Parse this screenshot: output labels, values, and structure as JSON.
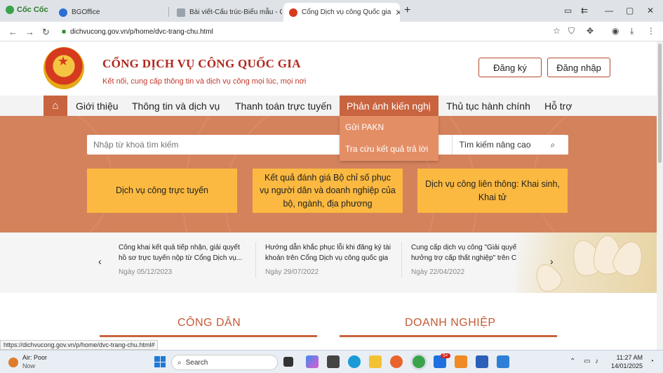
{
  "browser": {
    "brand": "Cốc Cốc",
    "tabs": [
      {
        "label": "BGOffice"
      },
      {
        "label": "Bài viết-Cấu trúc-Biểu mẫu - Cổng"
      },
      {
        "label": "Cổng Dịch vụ công Quốc gia"
      }
    ],
    "new_tab": "+",
    "url": "dichvucong.gov.vn/p/home/dvc-trang-chu.html",
    "status_url": "https://dichvucong.gov.vn/p/home/dvc-trang-chu.html#"
  },
  "site": {
    "title": "CỔNG DỊCH VỤ CÔNG QUỐC GIA",
    "slogan": "Kết nối, cung cấp thông tin và dịch vụ công mọi lúc, mọi nơi",
    "register": "Đăng ký",
    "login": "Đăng nhập"
  },
  "menu": {
    "items": [
      "Giới thiệu",
      "Thông tin và dịch vụ",
      "Thanh toán trực tuyến",
      "Phản ánh kiến nghị",
      "Thủ tục hành chính",
      "Hỗ trợ"
    ],
    "dropdown": [
      "Gửi PAKN",
      "Tra cứu kết quả trả lời"
    ]
  },
  "search": {
    "placeholder": "Nhập từ khoá tìm kiếm",
    "advanced": "Tìm kiếm nâng cao"
  },
  "cards": [
    "Dịch vụ công trực tuyến",
    "Kết quả đánh giá Bộ chỉ số phục vụ người dân và doanh nghiệp của bộ, ngành, địa phương",
    "Dịch vụ công liên thông: Khai sinh, Khai tử"
  ],
  "news": [
    {
      "title": "Công khai kết quả tiếp nhận, giải quyết hồ sơ trực tuyến nộp từ Cổng Dịch vụ...",
      "date": "Ngày 05/12/2023"
    },
    {
      "title": "Hướng dẫn khắc phục lỗi khi đăng ký tài khoản trên Cổng Dịch vụ công quốc gia",
      "date": "Ngày 29/07/2022"
    },
    {
      "title": "Cung cấp dịch vụ công \"Giải quyết hưởng trợ cấp thất nghiệp\" trên Cổng...",
      "date": "Ngày 22/04/2022"
    }
  ],
  "sections": [
    "CÔNG DÂN",
    "DOANH NGHIỆP"
  ],
  "taskbar": {
    "weather_title": "Air: Poor",
    "weather_sub": "Now",
    "search": "Search",
    "time": "11:27 AM",
    "date": "14/01/2025",
    "badge": "5+"
  },
  "colors": {
    "accent": "#c8643f",
    "banner": "#d4825c",
    "card": "#fbb941",
    "title": "#b0271c"
  }
}
